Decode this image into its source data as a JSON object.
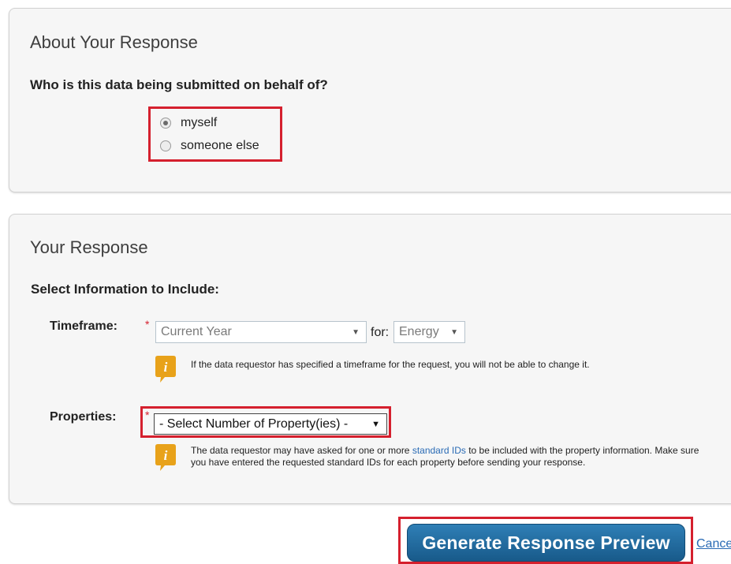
{
  "about": {
    "title": "About Your Response",
    "question": "Who is this data being submitted on behalf of?",
    "options": [
      {
        "label": "myself",
        "selected": true
      },
      {
        "label": "someone else",
        "selected": false
      }
    ]
  },
  "response": {
    "title": "Your Response",
    "subtitle": "Select Information to Include:",
    "timeframe": {
      "label": "Timeframe:",
      "required_mark": "*",
      "value": "Current Year",
      "for_label": "for:",
      "for_value": "Energy",
      "help": "If the data requestor has specified a timeframe for the request, you will not be able to change it."
    },
    "properties": {
      "label": "Properties:",
      "required_mark": "*",
      "value": "- Select Number of Property(ies) -",
      "help_before": "The data requestor may have asked for one or more ",
      "help_link": "standard IDs",
      "help_after": " to be included with the property information. Make sure you have entered the requested standard IDs for each property before sending your response."
    }
  },
  "actions": {
    "generate_label": "Generate Response Preview",
    "cancel_label": "Cancel"
  },
  "colors": {
    "highlight": "#d5202e",
    "button": "#1f6a9c",
    "info_icon": "#e8a21a",
    "link": "#2a6bb5"
  },
  "icons": [
    "radio-checked",
    "radio-unchecked",
    "dropdown-arrow-icon",
    "info-icon"
  ]
}
